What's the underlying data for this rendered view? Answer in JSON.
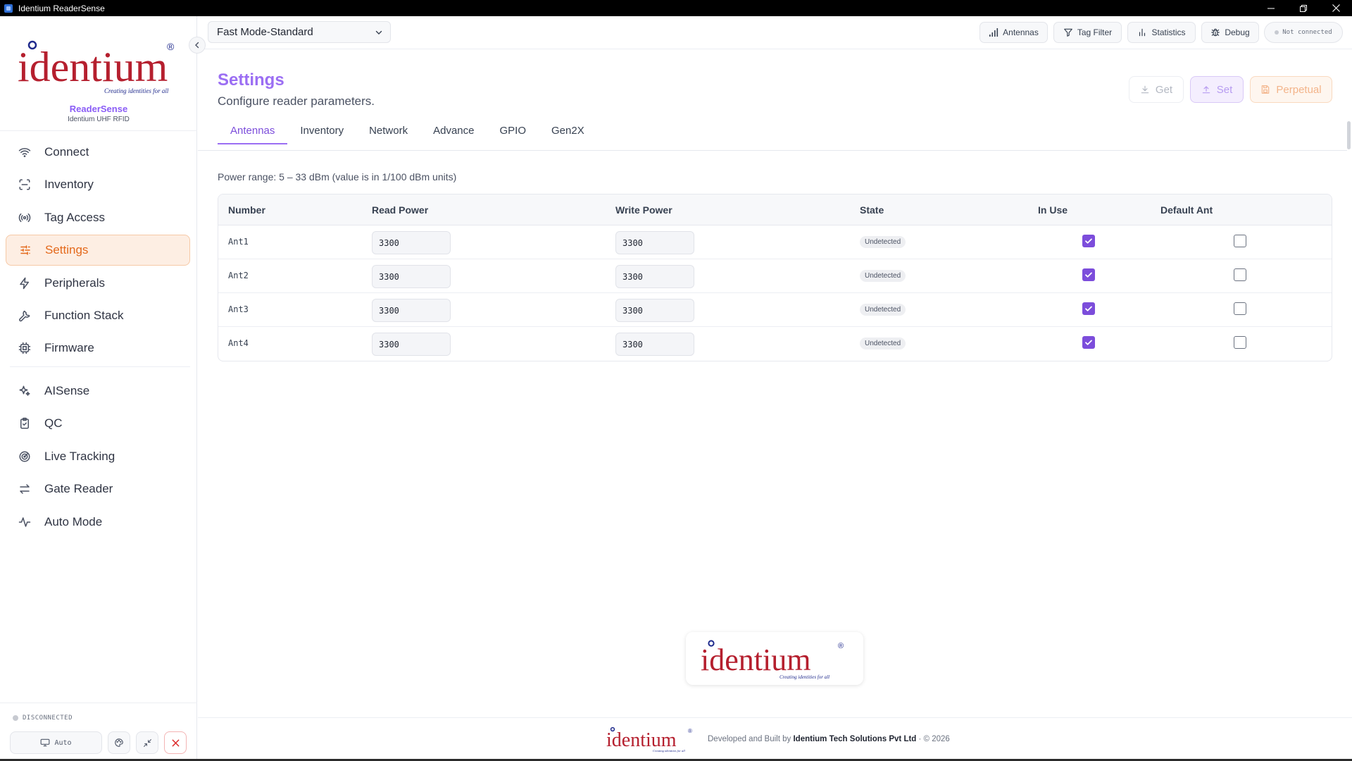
{
  "window": {
    "title": "Identium ReaderSense"
  },
  "brand": {
    "logo_text": "identium",
    "tagline": "Creating identities for all",
    "name": "ReaderSense",
    "subtitle": "Identium UHF RFID",
    "colors": {
      "primary_blue": "#1f2a8c",
      "primary_red": "#b51f2e",
      "accent_purple": "#9b6ef3",
      "accent_orange": "#e4691b"
    }
  },
  "sidebar": {
    "group1": [
      {
        "label": "Connect",
        "icon": "wifi-icon"
      },
      {
        "label": "Inventory",
        "icon": "scan-icon"
      },
      {
        "label": "Tag Access",
        "icon": "broadcast-icon"
      },
      {
        "label": "Settings",
        "icon": "sliders-icon",
        "active": true
      },
      {
        "label": "Peripherals",
        "icon": "lightning-icon"
      },
      {
        "label": "Function Stack",
        "icon": "wrench-icon"
      },
      {
        "label": "Firmware",
        "icon": "chip-icon"
      }
    ],
    "group2": [
      {
        "label": "AISense",
        "icon": "sparkles-icon"
      },
      {
        "label": "QC",
        "icon": "clipboard-check-icon"
      },
      {
        "label": "Live Tracking",
        "icon": "radar-icon"
      },
      {
        "label": "Gate Reader",
        "icon": "swap-arrows-icon"
      },
      {
        "label": "Auto Mode",
        "icon": "pulse-icon"
      }
    ],
    "footer": {
      "status": "DISCONNECTED",
      "auto_label": "Auto"
    }
  },
  "topbar": {
    "mode": "Fast Mode-Standard",
    "buttons": [
      "Antennas",
      "Tag Filter",
      "Statistics",
      "Debug"
    ],
    "connection": "Not connected"
  },
  "page": {
    "title": "Settings",
    "subtitle": "Configure reader parameters.",
    "actions": [
      "Get",
      "Set",
      "Perpetual"
    ],
    "tabs": [
      "Antennas",
      "Inventory",
      "Network",
      "Advance",
      "GPIO",
      "Gen2X"
    ],
    "active_tab": "Antennas",
    "power_range": "Power range: 5 – 33 dBm (value is in 1/100 dBm units)"
  },
  "antenna_table": {
    "headers": [
      "Number",
      "Read Power",
      "Write Power",
      "State",
      "In Use",
      "Default Ant"
    ],
    "rows": [
      {
        "number": "Ant1",
        "read_power": "3300",
        "write_power": "3300",
        "state": "Undetected",
        "in_use": true,
        "default_ant": false
      },
      {
        "number": "Ant2",
        "read_power": "3300",
        "write_power": "3300",
        "state": "Undetected",
        "in_use": true,
        "default_ant": false
      },
      {
        "number": "Ant3",
        "read_power": "3300",
        "write_power": "3300",
        "state": "Undetected",
        "in_use": true,
        "default_ant": false
      },
      {
        "number": "Ant4",
        "read_power": "3300",
        "write_power": "3300",
        "state": "Undetected",
        "in_use": true,
        "default_ant": false
      }
    ]
  },
  "footer": {
    "prefix": "Developed and Built by",
    "company": "Identium Tech Solutions Pvt Ltd",
    "suffix": "· © 2026"
  }
}
